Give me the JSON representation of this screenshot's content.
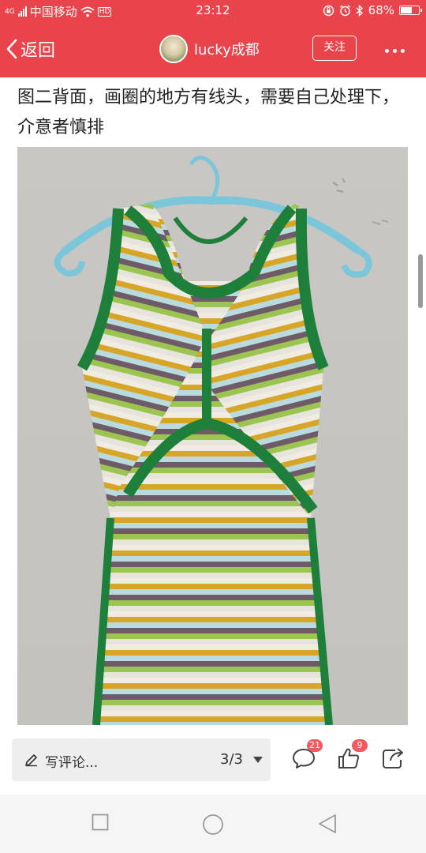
{
  "status_bar": {
    "network": "4G",
    "carrier": "中国移动",
    "hd": "HD",
    "time": "23:12",
    "battery_text": "68%",
    "battery_level": 0.68
  },
  "nav": {
    "back_label": "返回",
    "username": "lucky成都",
    "follow_label": "关注"
  },
  "post": {
    "caption": "图二背面，画圈的地方有线头，需要自己处理下，介意者慎排"
  },
  "bottom": {
    "comment_placeholder": "写评论...",
    "page_indicator": "3/3",
    "comment_count": "21",
    "like_count": "9"
  },
  "colors": {
    "brand": "#e9434b",
    "badge": "#f15a5e",
    "knit_green": "#1e7f3a",
    "hanger_blue": "#7cc6d9"
  },
  "icons": [
    "wifi-icon",
    "lock-rotate-icon",
    "alarm-icon",
    "bluetooth-icon",
    "battery-icon",
    "back-chevron-icon",
    "more-icon",
    "pen-icon",
    "caret-down-icon",
    "comment-icon",
    "like-icon",
    "share-icon",
    "square-nav-icon",
    "circle-nav-icon",
    "triangle-back-nav-icon"
  ]
}
